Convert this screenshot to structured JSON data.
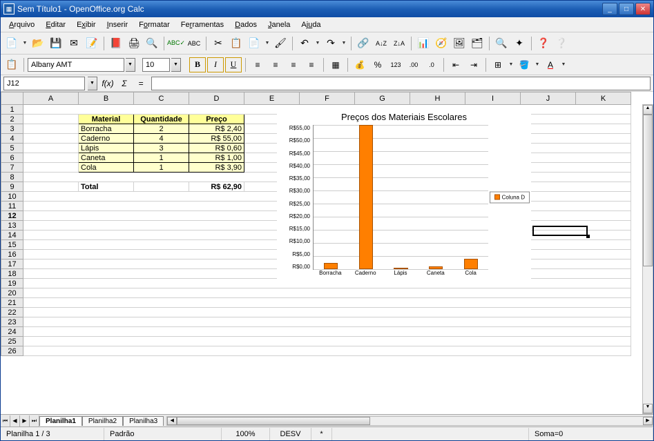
{
  "titlebar": {
    "title": "Sem Título1 - OpenOffice.org Calc"
  },
  "menu": {
    "arquivo": "Arquivo",
    "editar": "Editar",
    "exibir": "Exibir",
    "inserir": "Inserir",
    "formatar": "Formatar",
    "ferramentas": "Ferramentas",
    "dados": "Dados",
    "janela": "Janela",
    "ajuda": "Ajuda"
  },
  "font": {
    "name": "Albany AMT",
    "size": "10"
  },
  "formula": {
    "cellref": "J12"
  },
  "table": {
    "headers": {
      "material": "Material",
      "quantidade": "Quantidade",
      "preco": "Preço"
    },
    "rows": [
      {
        "material": "Borracha",
        "quantidade": "2",
        "preco": "R$ 2,40"
      },
      {
        "material": "Caderno",
        "quantidade": "4",
        "preco": "R$ 55,00"
      },
      {
        "material": "Lápis",
        "quantidade": "3",
        "preco": "R$ 0,60"
      },
      {
        "material": "Caneta",
        "quantidade": "1",
        "preco": "R$ 1,00"
      },
      {
        "material": "Cola",
        "quantidade": "1",
        "preco": "R$ 3,90"
      }
    ],
    "total_label": "Total",
    "total_value": "R$ 62,90"
  },
  "chart_data": {
    "type": "bar",
    "title": "Preços dos Materiais Escolares",
    "categories": [
      "Borracha",
      "Caderno",
      "Lápis",
      "Caneta",
      "Cola"
    ],
    "values": [
      2.4,
      55.0,
      0.6,
      1.0,
      3.9
    ],
    "ylim": [
      0,
      55
    ],
    "yticks": [
      "R$55,00",
      "R$50,00",
      "R$45,00",
      "R$40,00",
      "R$35,00",
      "R$30,00",
      "R$25,00",
      "R$20,00",
      "R$15,00",
      "R$10,00",
      "R$5,00",
      "R$0,00"
    ],
    "legend": "Coluna D"
  },
  "tabs": {
    "t1": "Planilha1",
    "t2": "Planilha2",
    "t3": "Planilha3"
  },
  "status": {
    "sheet": "Planilha 1 / 3",
    "style": "Padrão",
    "zoom": "100%",
    "mode": "DESV",
    "mark": "*",
    "sum": "Soma=0"
  },
  "columns": [
    "A",
    "B",
    "C",
    "D",
    "E",
    "F",
    "G",
    "H",
    "I",
    "J",
    "K"
  ],
  "active_cell": "J12"
}
